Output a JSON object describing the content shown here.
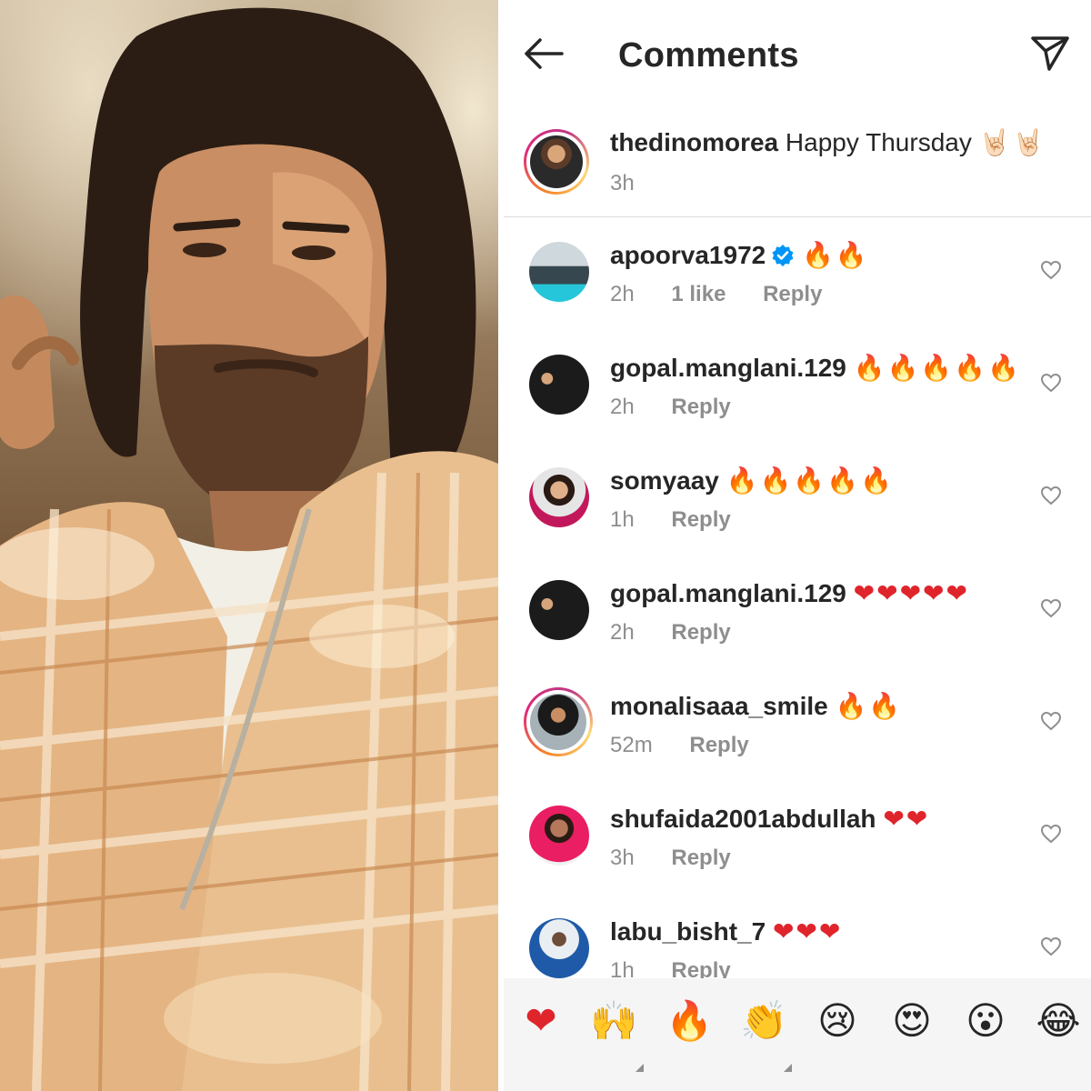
{
  "header": {
    "title": "Comments"
  },
  "caption": {
    "username": "thedinomorea",
    "text": "Happy Thursday",
    "emoji": "🤘🏻🤘🏻",
    "time": "3h"
  },
  "comments": [
    {
      "username": "apoorva1972",
      "verified": true,
      "emoji": "🔥🔥",
      "time": "2h",
      "likes": "1 like",
      "reply": "Reply"
    },
    {
      "username": "gopal.manglani.129",
      "emoji": "🔥🔥🔥🔥🔥",
      "time": "2h",
      "reply": "Reply"
    },
    {
      "username": "somyaay",
      "emoji": "🔥🔥🔥🔥🔥",
      "time": "1h",
      "reply": "Reply"
    },
    {
      "username": "gopal.manglani.129",
      "emoji": "❤❤❤❤❤",
      "time": "2h",
      "reply": "Reply"
    },
    {
      "username": "monalisaaa_smile",
      "emoji": "🔥🔥",
      "time": "52m",
      "reply": "Reply"
    },
    {
      "username": "shufaida2001abdullah",
      "emoji": "❤❤",
      "time": "3h",
      "reply": "Reply"
    },
    {
      "username": "labu_bisht_7",
      "emoji": "❤❤❤",
      "time": "1h",
      "reply": "Reply"
    }
  ],
  "reactions": [
    "❤",
    "🙌",
    "🔥",
    "👏",
    "😢",
    "😍",
    "😮",
    "😂"
  ],
  "colors": {
    "accent": "#0095f6",
    "muted": "#8e8e8e",
    "text": "#262626",
    "heart_red": "#e0242b",
    "fire_orange": "#f26a1b"
  }
}
